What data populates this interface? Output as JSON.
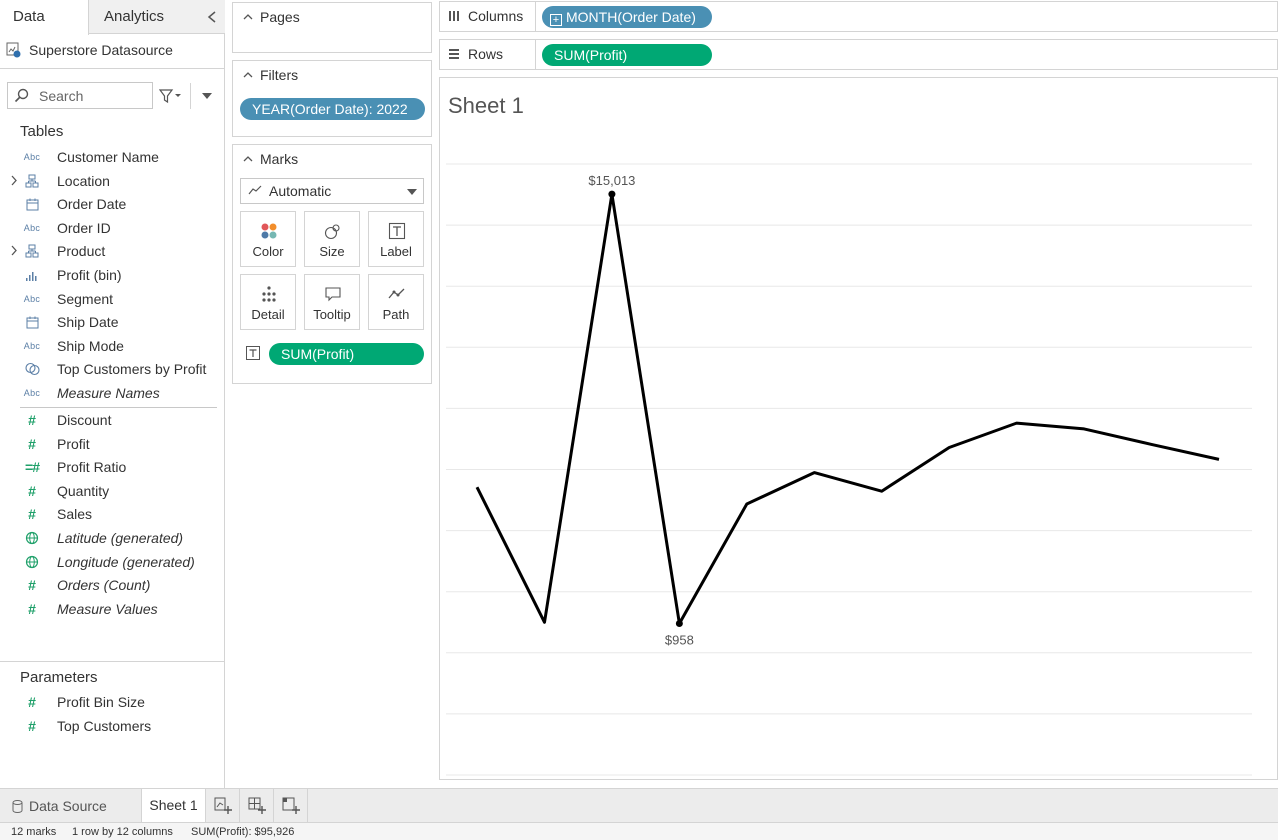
{
  "data_pane": {
    "tab_data": "Data",
    "tab_analytics": "Analytics",
    "datasource": "Superstore Datasource",
    "search_placeholder": "Search",
    "tables_title": "Tables",
    "dimensions": [
      {
        "label": "Customer Name",
        "icon": "abc-icon",
        "expandable": false
      },
      {
        "label": "Location",
        "icon": "hierarchy-icon",
        "expandable": true
      },
      {
        "label": "Order Date",
        "icon": "calendar-icon",
        "expandable": false
      },
      {
        "label": "Order ID",
        "icon": "abc-icon",
        "expandable": false
      },
      {
        "label": "Product",
        "icon": "hierarchy-icon",
        "expandable": true
      },
      {
        "label": "Profit (bin)",
        "icon": "bin-icon",
        "expandable": false
      },
      {
        "label": "Segment",
        "icon": "abc-icon",
        "expandable": false
      },
      {
        "label": "Ship Date",
        "icon": "calendar-icon",
        "expandable": false
      },
      {
        "label": "Ship Mode",
        "icon": "abc-icon",
        "expandable": false
      },
      {
        "label": "Top Customers by Profit",
        "icon": "set-icon",
        "expandable": false
      },
      {
        "label": "Measure Names",
        "icon": "abc-icon",
        "expandable": false,
        "italic": true
      }
    ],
    "measures": [
      {
        "label": "Discount",
        "icon": "number-icon"
      },
      {
        "label": "Profit",
        "icon": "number-icon"
      },
      {
        "label": "Profit Ratio",
        "icon": "calc-number-icon"
      },
      {
        "label": "Quantity",
        "icon": "number-icon"
      },
      {
        "label": "Sales",
        "icon": "number-icon"
      },
      {
        "label": "Latitude (generated)",
        "icon": "globe-icon",
        "italic": true
      },
      {
        "label": "Longitude (generated)",
        "icon": "globe-icon",
        "italic": true
      },
      {
        "label": "Orders (Count)",
        "icon": "number-icon",
        "italic": true
      },
      {
        "label": "Measure Values",
        "icon": "number-icon",
        "italic": true
      }
    ],
    "parameters_title": "Parameters",
    "parameters": [
      {
        "label": "Profit Bin Size",
        "icon": "number-icon"
      },
      {
        "label": "Top Customers",
        "icon": "number-icon"
      }
    ]
  },
  "cards": {
    "pages_title": "Pages",
    "filters_title": "Filters",
    "filter_pill": "YEAR(Order Date): 2022",
    "marks_title": "Marks",
    "mark_type": "Automatic",
    "buttons": {
      "color": "Color",
      "size": "Size",
      "label": "Label",
      "detail": "Detail",
      "tooltip": "Tooltip",
      "path": "Path"
    },
    "marks_pill": "SUM(Profit)"
  },
  "shelves": {
    "columns_label": "Columns",
    "columns_pill": "MONTH(Order Date)",
    "rows_label": "Rows",
    "rows_pill": "SUM(Profit)"
  },
  "sheet": {
    "title": "Sheet 1"
  },
  "chart_data": {
    "type": "line",
    "x": [
      1,
      2,
      3,
      4,
      5,
      6,
      7,
      8,
      9,
      10,
      11,
      12
    ],
    "values": [
      5420,
      1000,
      15013,
      958,
      4870,
      5900,
      5290,
      6720,
      7520,
      7330,
      6820,
      6330
    ],
    "point_labels": {
      "2": "$15,013",
      "3": "$958"
    },
    "ylim": [
      -4000,
      16000
    ],
    "grid": true,
    "line_color": "#000000"
  },
  "bottom_tabs": {
    "data_source": "Data Source",
    "sheet1": "Sheet 1"
  },
  "status": {
    "marks": "12 marks",
    "dims": "1 row by 12 columns",
    "sum": "SUM(Profit): $95,926"
  },
  "colors": {
    "blue_pill": "#4a90b4",
    "green_pill": "#00a874"
  }
}
